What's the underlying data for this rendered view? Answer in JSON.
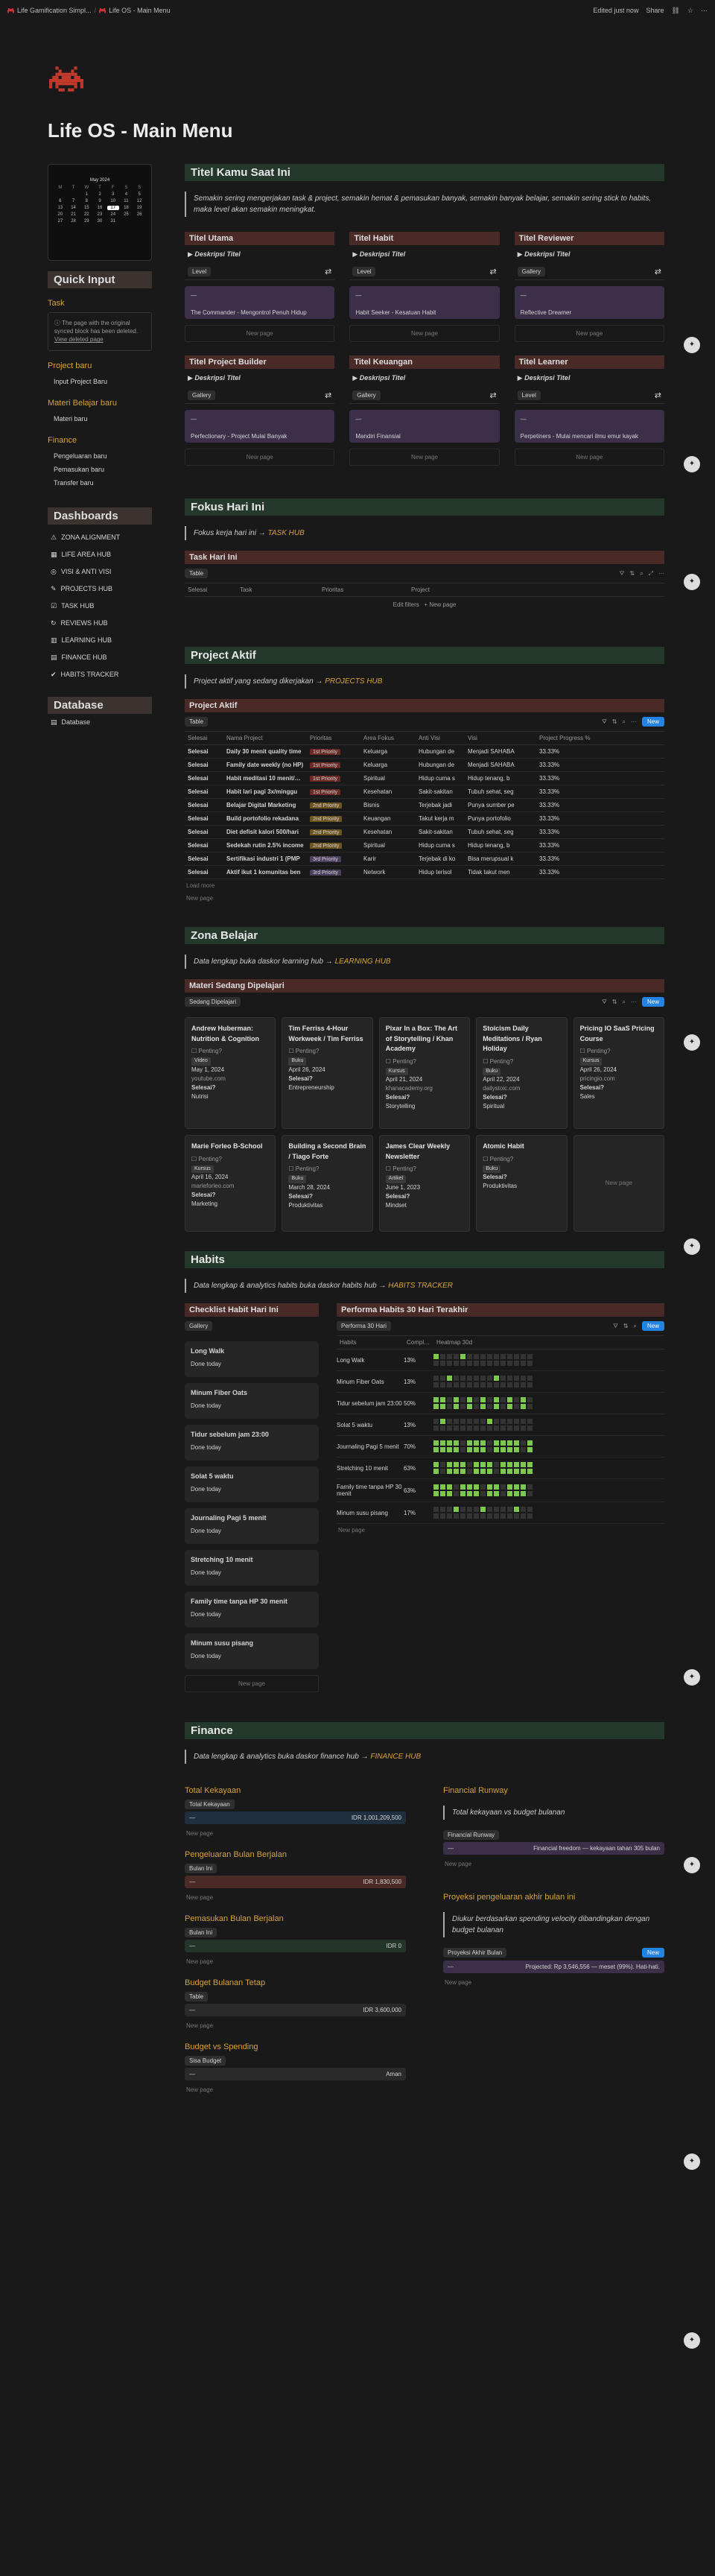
{
  "topbar": {
    "crumb1": "Life Gamification Simpl...",
    "crumb2": "Life OS - Main Menu",
    "edited": "Edited just now",
    "share": "Share"
  },
  "page": {
    "title": "Life OS - Main Menu"
  },
  "calendar": {
    "month": "May 2024",
    "days": [
      "M",
      "T",
      "W",
      "T",
      "F",
      "S",
      "S"
    ],
    "dates": [
      "",
      "",
      "1",
      "2",
      "3",
      "4",
      "5",
      "6",
      "7",
      "8",
      "9",
      "10",
      "11",
      "12",
      "13",
      "14",
      "15",
      "16",
      "17",
      "18",
      "19",
      "20",
      "21",
      "22",
      "23",
      "24",
      "25",
      "26",
      "27",
      "28",
      "29",
      "30",
      "31",
      "",
      ""
    ],
    "today": "17"
  },
  "sidebar": {
    "quick_input": "Quick Input",
    "task": "Task",
    "spin_msg": "The page with the original synced block has been deleted.",
    "spin_link": "View deleted page",
    "project_baru": "Project baru",
    "input_project": "Input Project Baru",
    "materi_baru_h": "Materi Belajar baru",
    "materi_baru": "Materi baru",
    "finance": "Finance",
    "fin_links": [
      "Pengeluaran baru",
      "Pemasukan baru",
      "Transfer baru"
    ],
    "dashboards": "Dashboards",
    "hubs": [
      "ZONA ALIGNMENT",
      "LIFE AREA HUB",
      "VISI & ANTI VISI",
      "PROJECTS HUB",
      "TASK HUB",
      "REVIEWS HUB",
      "LEARNING HUB",
      "FINANCE HUB",
      "HABITS TRACKER"
    ],
    "database": "Database",
    "database_link": "Database"
  },
  "title_section": {
    "h": "Titel Kamu Saat Ini",
    "quote": "Semakin sering mengerjakan task & project, semakin hemat & pemasukan banyak, semakin banyak belajar, semakin sering stick to habits, maka level akan semakin meningkat.",
    "titles": [
      {
        "h": "Titel Utama",
        "desc": "Deskripsi Titel",
        "view": "Level",
        "card": "The Commander - Mengontrol Penuh Hidup"
      },
      {
        "h": "Titel Habit",
        "desc": "Deskripsi Titel",
        "view": "Level",
        "card": "Habit Seeker - Kesatuan Habit"
      },
      {
        "h": "Titel Reviewer",
        "desc": "Deskripsi Titel",
        "view": "Gallery",
        "card": "Reflective Dreamer"
      },
      {
        "h": "Titel Project Builder",
        "desc": "Deskripsi Titel",
        "view": "Gallery",
        "card": "Perfectionary - Project Mulai Banyak"
      },
      {
        "h": "Titel Keuangan",
        "desc": "Deskripsi Titel",
        "view": "Gallery",
        "card": "Mandiri Finansial"
      },
      {
        "h": "Titel Learner",
        "desc": "Deskripsi Titel",
        "view": "Level",
        "card": "Perpetiners - Mulai mencari ilmu emur kayak"
      }
    ],
    "new_page": "New page"
  },
  "fokus": {
    "h": "Fokus Hari Ini",
    "quote": "Fokus kerja hari ini",
    "link": "TASK HUB",
    "sub": "Task Hari Ini",
    "view": "Table",
    "cols": [
      "Selesai",
      "Task",
      "Prioritas",
      "Project"
    ],
    "edit_filters": "Edit filters",
    "new_page": "New page"
  },
  "project": {
    "h": "Project Aktif",
    "quote": "Project aktif yang sedang dikerjakan",
    "link": "PROJECTS HUB",
    "sub": "Project Aktif",
    "view": "Table",
    "new": "New",
    "cols": [
      "Selesai",
      "Nama Project",
      "Prioritas",
      "Area Fokus",
      "Anti Visi",
      "Visi",
      "Project Progress %"
    ],
    "rows": [
      {
        "s": "Selesai",
        "n": "Daily 30 menit quality time",
        "p": "1st Priority",
        "pc": "p-high",
        "a": "Keluarga",
        "av": "Hubungan de",
        "v": "Menjadi SAHABA",
        "pr": "33.33%"
      },
      {
        "s": "Selesai",
        "n": "Family date weekly (no HP)",
        "p": "1st Priority",
        "pc": "p-high",
        "a": "Keluarga",
        "av": "Hubungan de",
        "v": "Menjadi SAHABA",
        "pr": "33.33%"
      },
      {
        "s": "Selesai",
        "n": "Habit meditasi 10 menit/hari",
        "p": "1st Priority",
        "pc": "p-high",
        "a": "Spiritual",
        "av": "Hidup cuma s",
        "v": "Hidup tenang, b",
        "pr": "33.33%"
      },
      {
        "s": "Selesai",
        "n": "Habit lari pagi 3x/minggu",
        "p": "1st Priority",
        "pc": "p-high",
        "a": "Kesehatan",
        "av": "Sakit-sakitan",
        "v": "Tubuh sehat, seg",
        "pr": "33.33%"
      },
      {
        "s": "Selesai",
        "n": "Belajar Digital Marketing",
        "p": "2nd Priority",
        "pc": "p-mid",
        "a": "Bisnis",
        "av": "Terjebak jadi",
        "v": "Punya sumber pe",
        "pr": "33.33%"
      },
      {
        "s": "Selesai",
        "n": "Build portofolio rekadana",
        "p": "2nd Priority",
        "pc": "p-mid",
        "a": "Keuangan",
        "av": "Takut kerja m",
        "v": "Punya portofolio",
        "pr": "33.33%"
      },
      {
        "s": "Selesai",
        "n": "Diet defisit kalori 500/hari",
        "p": "2nd Priority",
        "pc": "p-mid",
        "a": "Kesehatan",
        "av": "Sakit-sakitan",
        "v": "Tubuh sehat, seg",
        "pr": "33.33%"
      },
      {
        "s": "Selesai",
        "n": "Sedekah rutin 2.5% income",
        "p": "2nd Priority",
        "pc": "p-mid",
        "a": "Spiritual",
        "av": "Hidup cuma s",
        "v": "Hidup tenang, b",
        "pr": "33.33%"
      },
      {
        "s": "Selesai",
        "n": "Sertifikasi industri 1 (PMP",
        "p": "3rd Priority",
        "pc": "p-low",
        "a": "Karir",
        "av": "Terjebak di ko",
        "v": "Bisa merupsual k",
        "pr": "33.33%"
      },
      {
        "s": "Selesai",
        "n": "Aktif ikut 1 komunitas ben",
        "p": "3rd Priority",
        "pc": "p-low",
        "a": "Network",
        "av": "Hidup terisol",
        "v": "Tidak takut men",
        "pr": "33.33%"
      }
    ],
    "load_more": "Load more",
    "new_page": "New page"
  },
  "belajar": {
    "h": "Zona Belajar",
    "quote": "Data lengkap buka daskor learning hub",
    "link": "LEARNING HUB",
    "sub": "Materi Sedang Dipelajari",
    "view": "Sedang Dipelajari",
    "new": "New",
    "cards": [
      {
        "t": "Andrew Huberman: Nutrition & Cognition",
        "status": "Penting?",
        "kind": "Video",
        "date": "May 1, 2024",
        "url": "youtube.com",
        "done": "Selesai?",
        "area": "Nutrisi"
      },
      {
        "t": "Tim Ferriss 4-Hour Workweek / Tim Ferriss",
        "status": "Penting?",
        "kind": "Buku",
        "date": "April 26, 2024",
        "url": "",
        "done": "Selesai?",
        "area": "Entrepreneurship"
      },
      {
        "t": "Pixar In a Box: The Art of Storytelling / Khan Academy",
        "status": "Penting?",
        "kind": "Kursus",
        "date": "April 21, 2024",
        "url": "khanacademy.org",
        "done": "Selesai?",
        "area": "Storytelling"
      },
      {
        "t": "Stoicism Daily Meditations / Ryan Holiday",
        "status": "Penting?",
        "kind": "Buku",
        "date": "April 22, 2024",
        "url": "dailystoic.com",
        "done": "Selesai?",
        "area": "Spiritual"
      },
      {
        "t": "Pricing IO SaaS Pricing Course",
        "status": "Penting?",
        "kind": "Kursus",
        "date": "April 26, 2024",
        "url": "pricingio.com",
        "done": "Selesai?",
        "area": "Sales"
      },
      {
        "t": "Marie Forleo B-School",
        "status": "Penting?",
        "kind": "Kursus",
        "date": "April 16, 2024",
        "url": "marieforleo.com",
        "done": "Selesai?",
        "area": "Marketing"
      },
      {
        "t": "Building a Second Brain / Tiago Forte",
        "status": "Penting?",
        "kind": "Buku",
        "date": "March 28, 2024",
        "url": "",
        "done": "Selesai?",
        "area": "Produktivitas"
      },
      {
        "t": "James Clear Weekly Newsletter",
        "status": "Penting?",
        "kind": "Artikel",
        "date": "June 1, 2023",
        "url": "",
        "done": "Selesai?",
        "area": "Mindset"
      },
      {
        "t": "Atomic Habit",
        "status": "Penting?",
        "kind": "Buku",
        "date": "",
        "url": "",
        "done": "Selesai?",
        "area": "Produktivitas"
      }
    ],
    "new_page": "New page"
  },
  "habits": {
    "h": "Habits",
    "quote": "Data lengkap & analytics habits buka daskor habits hub",
    "link": "HABITS TRACKER",
    "left_h": "Checklist Habit Hari Ini",
    "left_view": "Gallery",
    "done": "Done today",
    "right_h": "Performa Habits 30 Hari Terakhir",
    "right_view": "Performa 30 Hari",
    "new": "New",
    "cols": [
      "Habits",
      "Comple...",
      "Heatmap 30d"
    ],
    "items": [
      {
        "n": "Long Walk",
        "p": "13%",
        "on": [
          0,
          4
        ]
      },
      {
        "n": "Minum Fiber Oats",
        "p": "13%",
        "on": [
          2,
          9
        ]
      },
      {
        "n": "Tidur sebelum jam 23:00",
        "p": "50%",
        "on": [
          0,
          1,
          3,
          5,
          7,
          9,
          11,
          13
        ]
      },
      {
        "n": "Solat 5 waktu",
        "p": "13%",
        "on": [
          1,
          8
        ]
      },
      {
        "n": "Journaling Pagi 5 menit",
        "p": "70%",
        "on": [
          0,
          1,
          2,
          3,
          5,
          6,
          7,
          9,
          10,
          11,
          12,
          14
        ]
      },
      {
        "n": "Stretching 10 menit",
        "p": "63%",
        "on": [
          0,
          2,
          3,
          4,
          6,
          7,
          8,
          10,
          11,
          12,
          13,
          14
        ]
      },
      {
        "n": "Family time tanpa HP 30 menit",
        "p": "63%",
        "on": [
          0,
          1,
          2,
          4,
          5,
          6,
          8,
          9,
          11,
          12,
          13
        ]
      },
      {
        "n": "Minum susu pisang",
        "p": "17%",
        "on": [
          3,
          7,
          12
        ]
      }
    ],
    "new_page": "New page"
  },
  "finance": {
    "h": "Finance",
    "quote": "Data lengkap & analytics buka daskor finance hub",
    "link": "FINANCE HUB",
    "total_h": "Total Kekayaan",
    "total_view": "Total Kekayaan",
    "total_val": "IDR 1,001,209,500",
    "out_h": "Pengeluaran Bulan Berjalan",
    "out_view": "Bulan Ini",
    "out_val": "IDR 1,830,500",
    "in_h": "Pemasukan Bulan Berjalan",
    "in_view": "Bulan Ini",
    "in_val": "IDR 0",
    "budget_h": "Budget Bulanan Tetap",
    "budget_view": "Table",
    "budget_val": "IDR 3,600,000",
    "bvs_h": "Budget vs Spending",
    "bvs_view": "Sisa Budget",
    "bvs_val": "Aman",
    "runway_h": "Financial Runway",
    "runway_quote": "Total kekayaan vs budget bulanan",
    "runway_view": "Financial Runway",
    "runway_val": "Financial freedom — kekayaan tahan 305 bulan",
    "proj_h": "Proyeksi pengeluaran akhir bulan ini",
    "proj_quote": "Diukur berdasarkan spending velocity dibandingkan dengan budget bulanan",
    "proj_view": "Proyeksi Akhir Bulan",
    "proj_val": "Projected: Rp 3,546,556 — meset (99%). Hati-hati.",
    "new": "New",
    "new_page": "New page"
  }
}
